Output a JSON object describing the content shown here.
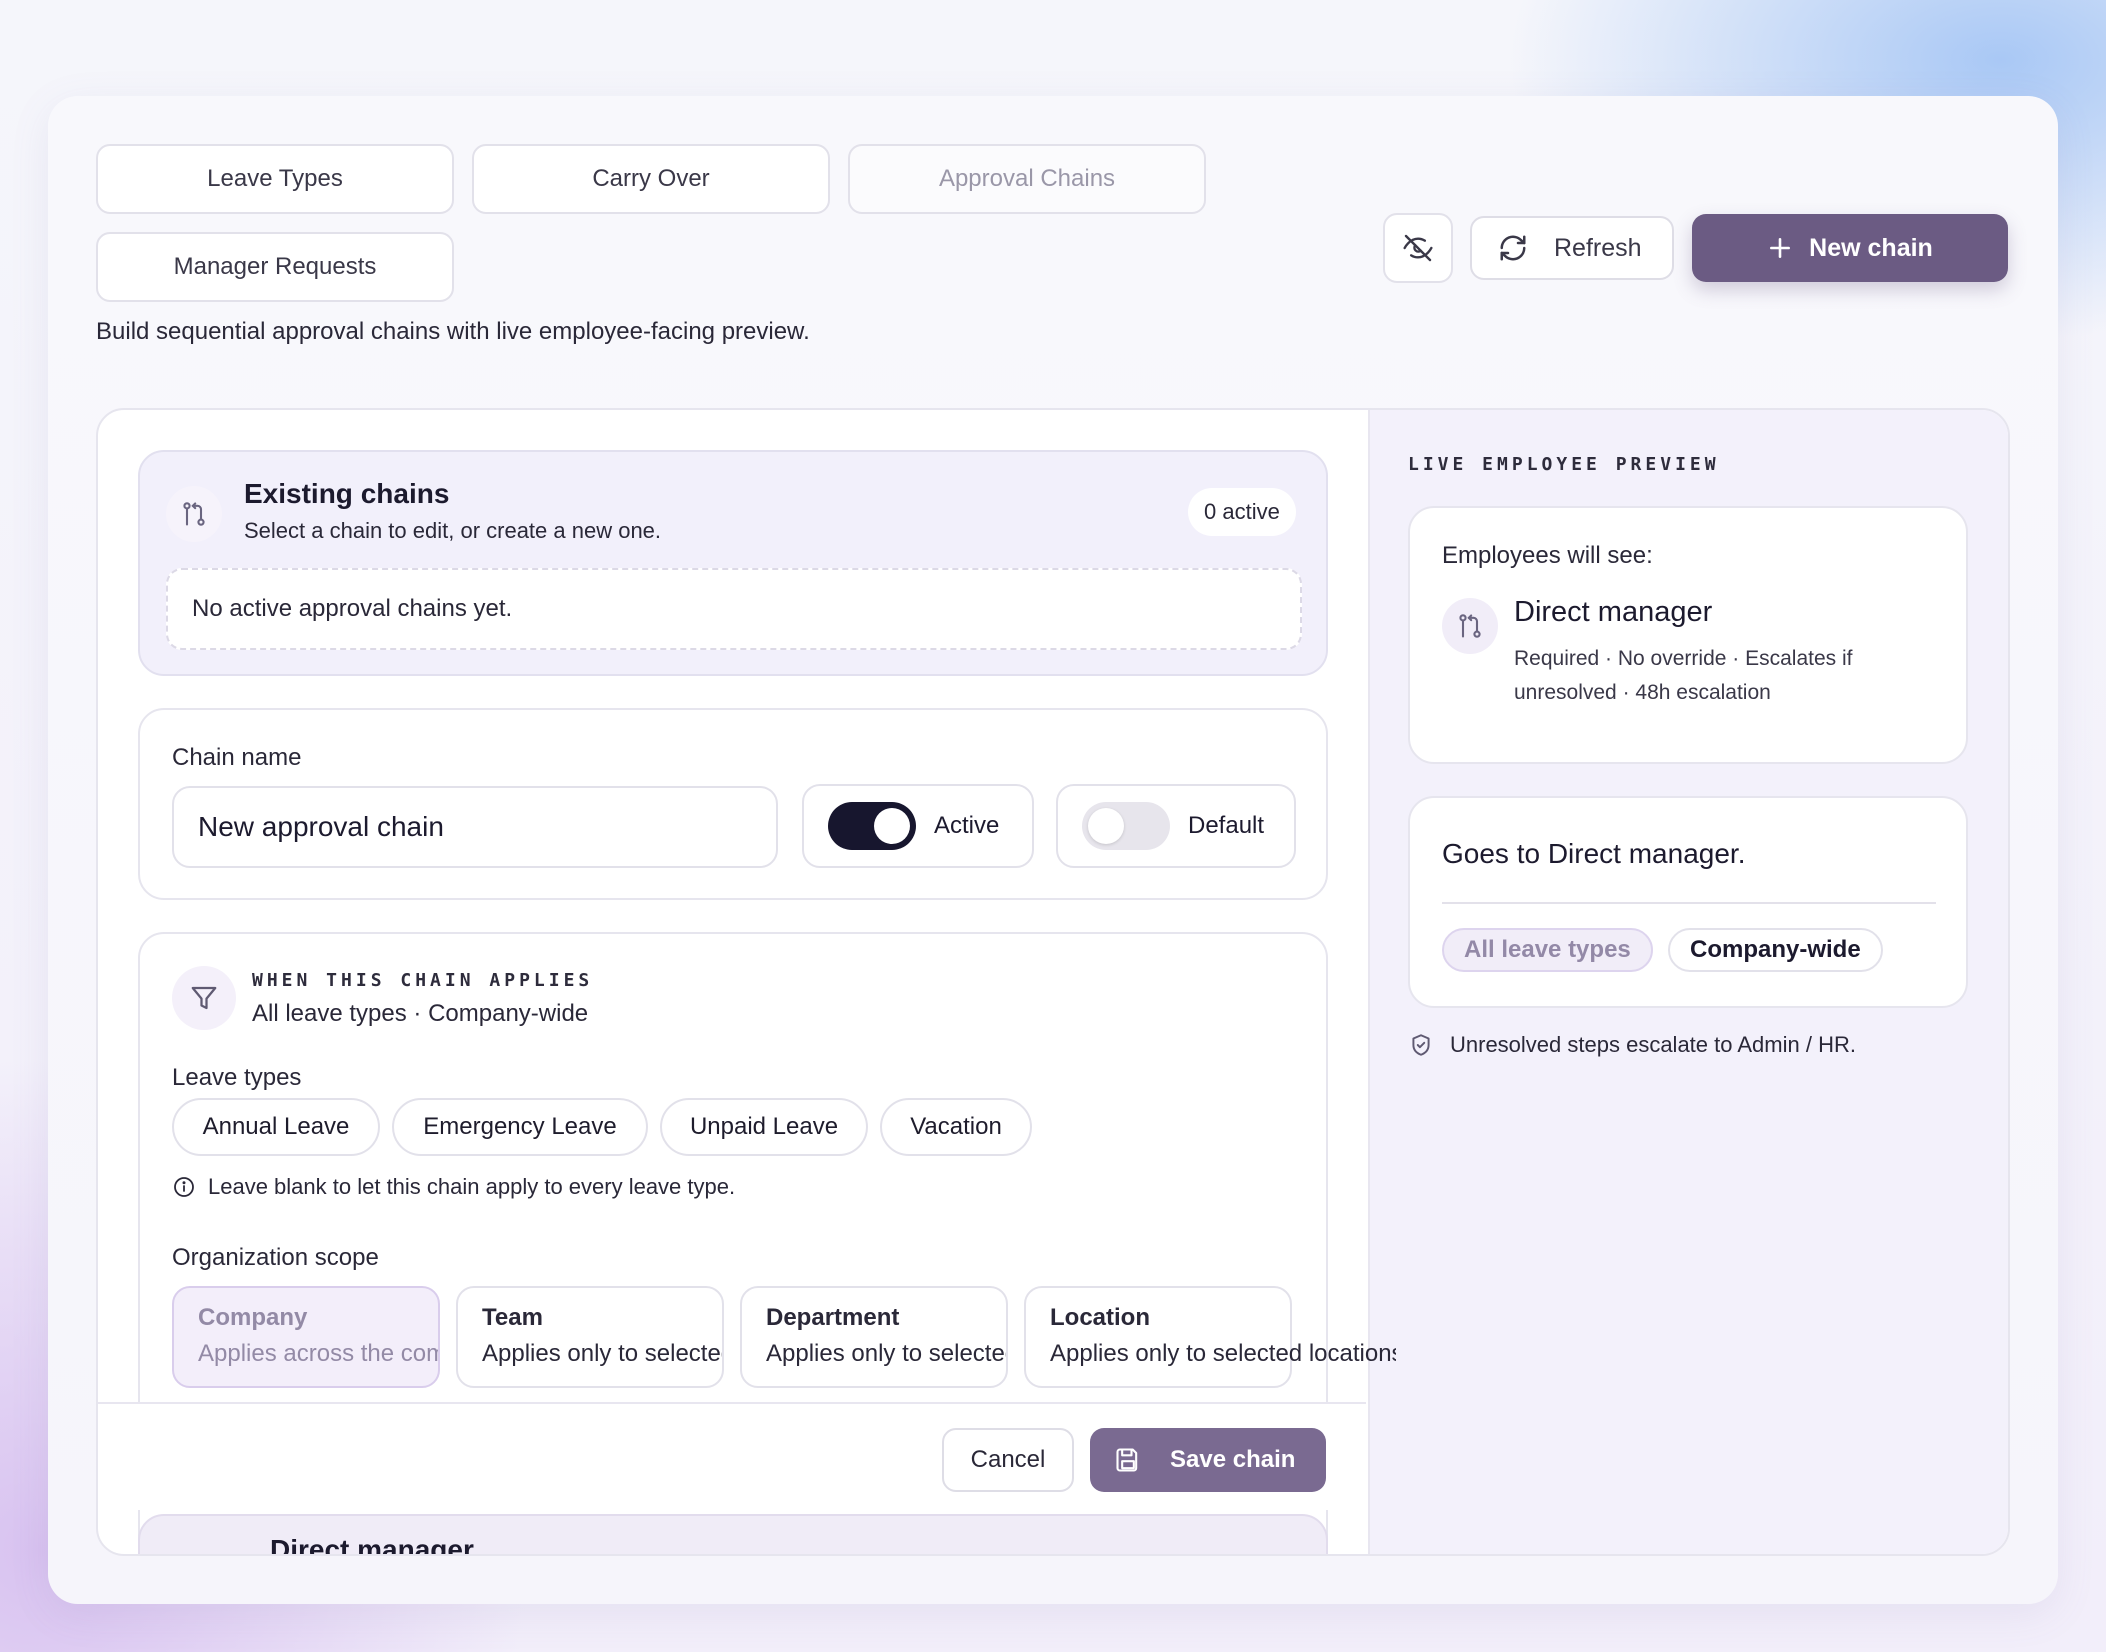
{
  "tabs": [
    {
      "label": "Leave Types"
    },
    {
      "label": "Carry Over"
    },
    {
      "label": "Approval Chains"
    },
    {
      "label": "Manager Requests"
    }
  ],
  "subtitle": "Build sequential approval chains with live employee-facing preview.",
  "actions": {
    "refresh_label": "Refresh",
    "new_chain_label": "New chain"
  },
  "existing": {
    "title": "Existing chains",
    "subtitle": "Select a chain to edit, or create a new one.",
    "badge": "0 active",
    "empty": "No active approval chains yet."
  },
  "chain": {
    "name_label": "Chain name",
    "name_value": "New approval chain",
    "active_label": "Active",
    "active_on": true,
    "default_label": "Default",
    "default_on": false
  },
  "applies": {
    "section_label": "WHEN THIS CHAIN APPLIES",
    "summary": "All leave types · Company-wide",
    "leave_types_label": "Leave types",
    "leave_types": [
      "Annual Leave",
      "Emergency Leave",
      "Unpaid Leave",
      "Vacation"
    ],
    "hint": "Leave blank to let this chain apply to every leave type.",
    "scope_label": "Organization scope",
    "scopes": [
      {
        "title": "Company",
        "desc": "Applies across the company"
      },
      {
        "title": "Team",
        "desc": "Applies only to selected teams"
      },
      {
        "title": "Department",
        "desc": "Applies only to selected departments"
      },
      {
        "title": "Location",
        "desc": "Applies only to selected locations"
      }
    ]
  },
  "footer": {
    "cancel_label": "Cancel",
    "save_label": "Save chain"
  },
  "step_peek": {
    "title": "Direct manager"
  },
  "preview": {
    "section_label": "LIVE EMPLOYEE PREVIEW",
    "intro": "Employees will see:",
    "step_title": "Direct manager",
    "step_meta": "Required · No override · Escalates if unresolved · 48h escalation",
    "goes_to": "Goes to Direct manager.",
    "tags": [
      "All leave types",
      "Company-wide"
    ],
    "escalation_note": "Unresolved steps escalate to Admin / HR."
  },
  "colors": {
    "accent": "#6b5b83",
    "toggle_on": "#17162e",
    "toggle_off": "#e7e5ec"
  }
}
